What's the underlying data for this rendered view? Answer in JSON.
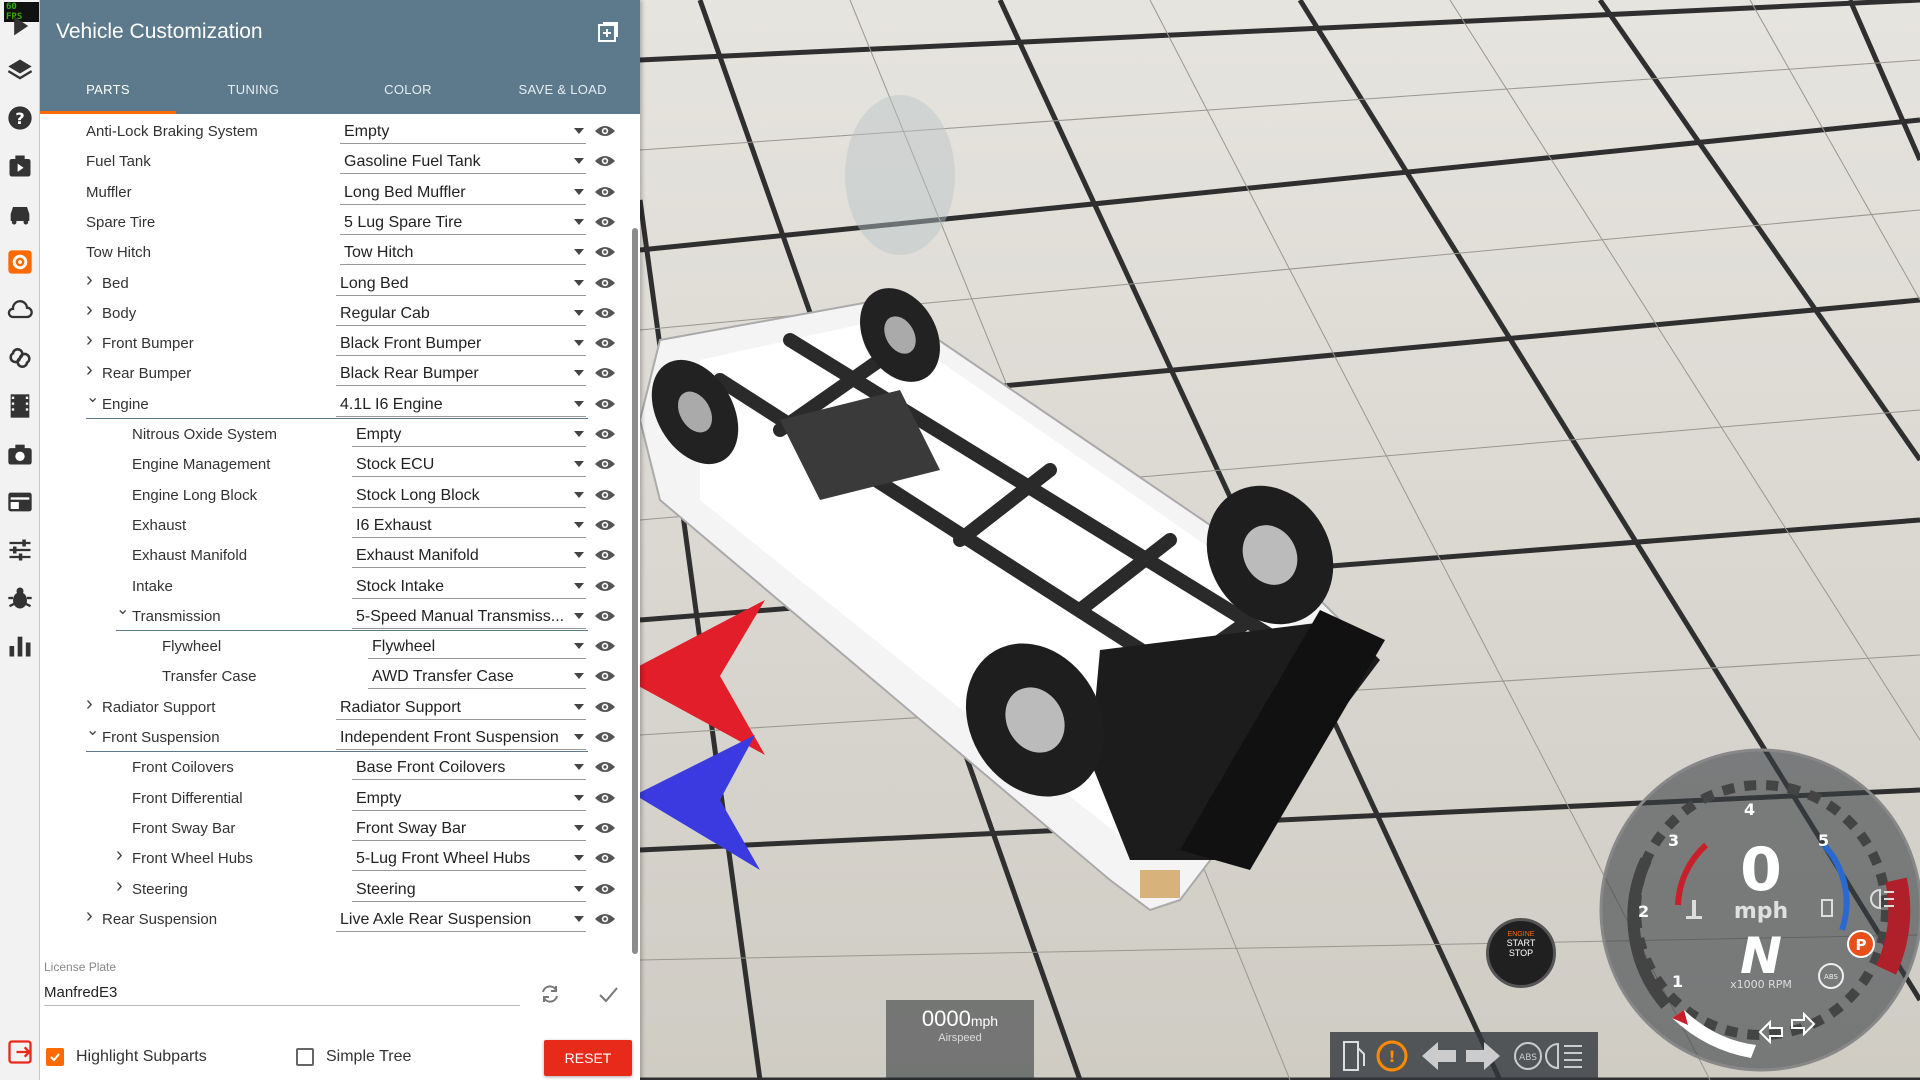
{
  "toolbar": {
    "fps": "60 FPS",
    "icons": [
      "play-icon",
      "layers-icon",
      "help-icon",
      "scenario-icon",
      "vehicle-icon",
      "customize-icon",
      "cloud-icon",
      "loop-icon",
      "replay-icon",
      "camera-icon",
      "environment-icon",
      "settings-icon",
      "debug-icon",
      "stats-icon",
      "exit-icon"
    ]
  },
  "panel": {
    "title": "Vehicle Customization",
    "tabs": [
      "PARTS",
      "TUNING",
      "COLOR",
      "SAVE & LOAD"
    ],
    "active_tab": "PARTS",
    "parts": [
      {
        "label": "Anti-Lock Braking System",
        "value": "Empty",
        "level": 0,
        "chevron": ""
      },
      {
        "label": "Fuel Tank",
        "value": "Gasoline Fuel Tank",
        "level": 0,
        "chevron": ""
      },
      {
        "label": "Muffler",
        "value": "Long Bed Muffler",
        "level": 0,
        "chevron": ""
      },
      {
        "label": "Spare Tire",
        "value": "5 Lug Spare Tire",
        "level": 0,
        "chevron": ""
      },
      {
        "label": "Tow Hitch",
        "value": "Tow Hitch",
        "level": 0,
        "chevron": ""
      },
      {
        "label": "Bed",
        "value": "Long Bed",
        "level": 0,
        "chevron": "collapsed"
      },
      {
        "label": "Body",
        "value": "Regular Cab",
        "level": 0,
        "chevron": "collapsed"
      },
      {
        "label": "Front Bumper",
        "value": "Black Front Bumper",
        "level": 0,
        "chevron": "collapsed"
      },
      {
        "label": "Rear Bumper",
        "value": "Black Rear Bumper",
        "level": 0,
        "chevron": "collapsed"
      },
      {
        "label": "Engine",
        "value": "4.1L I6 Engine",
        "level": 0,
        "chevron": "expanded"
      },
      {
        "label": "Nitrous Oxide System",
        "value": "Empty",
        "level": 1,
        "chevron": ""
      },
      {
        "label": "Engine Management",
        "value": "Stock ECU",
        "level": 1,
        "chevron": ""
      },
      {
        "label": "Engine Long Block",
        "value": "Stock Long Block",
        "level": 1,
        "chevron": ""
      },
      {
        "label": "Exhaust",
        "value": "I6 Exhaust",
        "level": 1,
        "chevron": ""
      },
      {
        "label": "Exhaust Manifold",
        "value": "Exhaust Manifold",
        "level": 1,
        "chevron": ""
      },
      {
        "label": "Intake",
        "value": "Stock Intake",
        "level": 1,
        "chevron": ""
      },
      {
        "label": "Transmission",
        "value": "5-Speed Manual Transmiss...",
        "level": 1,
        "chevron": "expanded"
      },
      {
        "label": "Flywheel",
        "value": "Flywheel",
        "level": 2,
        "chevron": ""
      },
      {
        "label": "Transfer Case",
        "value": "AWD Transfer Case",
        "level": 2,
        "chevron": ""
      },
      {
        "label": "Radiator Support",
        "value": "Radiator Support",
        "level": 0,
        "chevron": "collapsed"
      },
      {
        "label": "Front Suspension",
        "value": "Independent Front Suspension",
        "level": 0,
        "chevron": "expanded"
      },
      {
        "label": "Front Coilovers",
        "value": "Base Front Coilovers",
        "level": 1,
        "chevron": ""
      },
      {
        "label": "Front Differential",
        "value": "Empty",
        "level": 1,
        "chevron": ""
      },
      {
        "label": "Front Sway Bar",
        "value": "Front Sway Bar",
        "level": 1,
        "chevron": ""
      },
      {
        "label": "Front Wheel Hubs",
        "value": "5-Lug Front Wheel Hubs",
        "level": 1,
        "chevron": "collapsed"
      },
      {
        "label": "Steering",
        "value": "Steering",
        "level": 1,
        "chevron": "collapsed"
      },
      {
        "label": "Rear Suspension",
        "value": "Live Axle Rear Suspension",
        "level": 0,
        "chevron": "collapsed"
      }
    ],
    "license_plate_label": "License Plate",
    "license_plate_value": "ManfredE3",
    "highlight_subparts_label": "Highlight Subparts",
    "highlight_subparts_checked": true,
    "simple_tree_label": "Simple Tree",
    "simple_tree_checked": false,
    "reset_label": "RESET"
  },
  "hud": {
    "airspeed_value": "0000",
    "airspeed_unit": "mph",
    "airspeed_caption": "Airspeed",
    "engine_button_lines": [
      "ENGINE",
      "START",
      "STOP"
    ],
    "speed_value": "0",
    "speed_unit": "mph",
    "gear": "N",
    "rpm_unit": "x1000 RPM",
    "rpm_ticks": [
      "1",
      "2",
      "3",
      "4",
      "5"
    ],
    "abs_label": "ABS",
    "parking_label": "P"
  },
  "colors": {
    "header": "#5c7a8c",
    "accent": "#ff6a00",
    "reset": "#e82a1a"
  }
}
